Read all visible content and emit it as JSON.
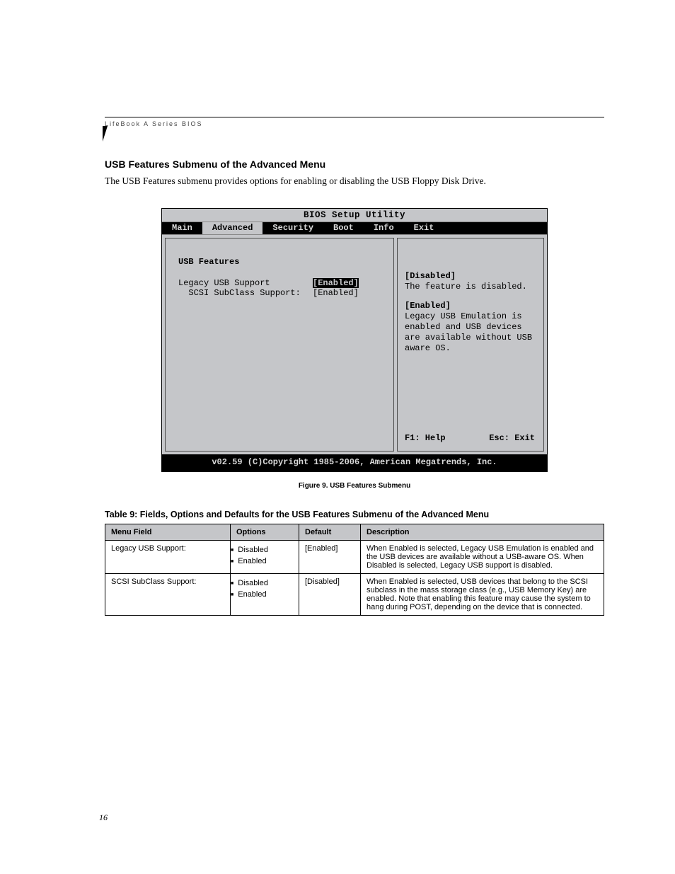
{
  "runningHead": "LifeBook A Series BIOS",
  "heading": "USB Features Submenu of the Advanced Menu",
  "intro": "The USB Features submenu provides options for enabling or disabling the USB Floppy Disk Drive.",
  "bios": {
    "title": "BIOS Setup Utility",
    "tabs": [
      "Main",
      "Advanced",
      "Security",
      "Boot",
      "Info",
      "Exit"
    ],
    "activeTab": "Advanced",
    "submenuTitle": "USB Features",
    "rows": [
      {
        "label": "Legacy USB Support",
        "value": "[Enabled]",
        "selected": true
      },
      {
        "label": "  SCSI SubClass Support:",
        "value": "[Enabled]",
        "selected": false
      }
    ],
    "help": {
      "disabledHdr": "[Disabled]",
      "disabledTxt": "The feature is disabled.",
      "enabledHdr": "[Enabled]",
      "enabledTxt": "Legacy USB Emulation is enabled and USB devices are available without USB aware OS."
    },
    "helpBar": {
      "left": "F1: Help",
      "right": "Esc: Exit"
    },
    "copyright": "v02.59 (C)Copyright 1985-2006, American Megatrends, Inc."
  },
  "figureCaption": "Figure 9.  USB Features Submenu",
  "tableCaption": "Table 9: Fields, Options and Defaults for the USB Features Submenu of the Advanced Menu",
  "tableHeaders": [
    "Menu Field",
    "Options",
    "Default",
    "Description"
  ],
  "tableRows": [
    {
      "field": "Legacy USB Support:",
      "options": [
        "Disabled",
        "Enabled"
      ],
      "default": "[Enabled]",
      "desc": "When Enabled is selected, Legacy USB Emulation is enabled and the USB devices are available without a USB-aware OS. When Disabled is selected, Legacy USB support is disabled."
    },
    {
      "field": "SCSI SubClass Support:",
      "options": [
        "Disabled",
        "Enabled"
      ],
      "default": "[Disabled]",
      "desc": "When Enabled is selected, USB devices that belong to the SCSI subclass in the mass storage class (e.g., USB Memory Key) are enabled. Note that enabling this feature may cause the system to hang during POST, depending on the device that is connected."
    }
  ],
  "pageNumber": "16"
}
